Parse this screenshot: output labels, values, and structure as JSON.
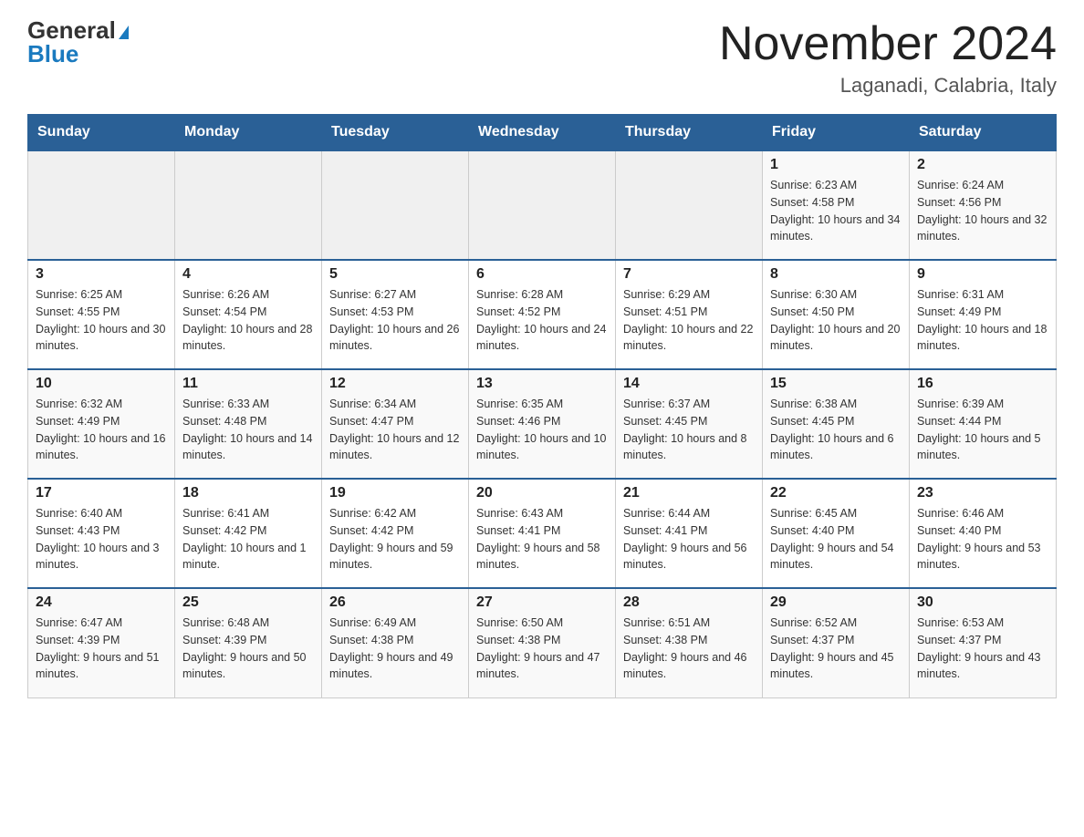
{
  "header": {
    "logo_general": "General",
    "logo_blue": "Blue",
    "title": "November 2024",
    "subtitle": "Laganadi, Calabria, Italy"
  },
  "days_of_week": [
    "Sunday",
    "Monday",
    "Tuesday",
    "Wednesday",
    "Thursday",
    "Friday",
    "Saturday"
  ],
  "weeks": [
    [
      {
        "day": "",
        "info": ""
      },
      {
        "day": "",
        "info": ""
      },
      {
        "day": "",
        "info": ""
      },
      {
        "day": "",
        "info": ""
      },
      {
        "day": "",
        "info": ""
      },
      {
        "day": "1",
        "info": "Sunrise: 6:23 AM\nSunset: 4:58 PM\nDaylight: 10 hours and 34 minutes."
      },
      {
        "day": "2",
        "info": "Sunrise: 6:24 AM\nSunset: 4:56 PM\nDaylight: 10 hours and 32 minutes."
      }
    ],
    [
      {
        "day": "3",
        "info": "Sunrise: 6:25 AM\nSunset: 4:55 PM\nDaylight: 10 hours and 30 minutes."
      },
      {
        "day": "4",
        "info": "Sunrise: 6:26 AM\nSunset: 4:54 PM\nDaylight: 10 hours and 28 minutes."
      },
      {
        "day": "5",
        "info": "Sunrise: 6:27 AM\nSunset: 4:53 PM\nDaylight: 10 hours and 26 minutes."
      },
      {
        "day": "6",
        "info": "Sunrise: 6:28 AM\nSunset: 4:52 PM\nDaylight: 10 hours and 24 minutes."
      },
      {
        "day": "7",
        "info": "Sunrise: 6:29 AM\nSunset: 4:51 PM\nDaylight: 10 hours and 22 minutes."
      },
      {
        "day": "8",
        "info": "Sunrise: 6:30 AM\nSunset: 4:50 PM\nDaylight: 10 hours and 20 minutes."
      },
      {
        "day": "9",
        "info": "Sunrise: 6:31 AM\nSunset: 4:49 PM\nDaylight: 10 hours and 18 minutes."
      }
    ],
    [
      {
        "day": "10",
        "info": "Sunrise: 6:32 AM\nSunset: 4:49 PM\nDaylight: 10 hours and 16 minutes."
      },
      {
        "day": "11",
        "info": "Sunrise: 6:33 AM\nSunset: 4:48 PM\nDaylight: 10 hours and 14 minutes."
      },
      {
        "day": "12",
        "info": "Sunrise: 6:34 AM\nSunset: 4:47 PM\nDaylight: 10 hours and 12 minutes."
      },
      {
        "day": "13",
        "info": "Sunrise: 6:35 AM\nSunset: 4:46 PM\nDaylight: 10 hours and 10 minutes."
      },
      {
        "day": "14",
        "info": "Sunrise: 6:37 AM\nSunset: 4:45 PM\nDaylight: 10 hours and 8 minutes."
      },
      {
        "day": "15",
        "info": "Sunrise: 6:38 AM\nSunset: 4:45 PM\nDaylight: 10 hours and 6 minutes."
      },
      {
        "day": "16",
        "info": "Sunrise: 6:39 AM\nSunset: 4:44 PM\nDaylight: 10 hours and 5 minutes."
      }
    ],
    [
      {
        "day": "17",
        "info": "Sunrise: 6:40 AM\nSunset: 4:43 PM\nDaylight: 10 hours and 3 minutes."
      },
      {
        "day": "18",
        "info": "Sunrise: 6:41 AM\nSunset: 4:42 PM\nDaylight: 10 hours and 1 minute."
      },
      {
        "day": "19",
        "info": "Sunrise: 6:42 AM\nSunset: 4:42 PM\nDaylight: 9 hours and 59 minutes."
      },
      {
        "day": "20",
        "info": "Sunrise: 6:43 AM\nSunset: 4:41 PM\nDaylight: 9 hours and 58 minutes."
      },
      {
        "day": "21",
        "info": "Sunrise: 6:44 AM\nSunset: 4:41 PM\nDaylight: 9 hours and 56 minutes."
      },
      {
        "day": "22",
        "info": "Sunrise: 6:45 AM\nSunset: 4:40 PM\nDaylight: 9 hours and 54 minutes."
      },
      {
        "day": "23",
        "info": "Sunrise: 6:46 AM\nSunset: 4:40 PM\nDaylight: 9 hours and 53 minutes."
      }
    ],
    [
      {
        "day": "24",
        "info": "Sunrise: 6:47 AM\nSunset: 4:39 PM\nDaylight: 9 hours and 51 minutes."
      },
      {
        "day": "25",
        "info": "Sunrise: 6:48 AM\nSunset: 4:39 PM\nDaylight: 9 hours and 50 minutes."
      },
      {
        "day": "26",
        "info": "Sunrise: 6:49 AM\nSunset: 4:38 PM\nDaylight: 9 hours and 49 minutes."
      },
      {
        "day": "27",
        "info": "Sunrise: 6:50 AM\nSunset: 4:38 PM\nDaylight: 9 hours and 47 minutes."
      },
      {
        "day": "28",
        "info": "Sunrise: 6:51 AM\nSunset: 4:38 PM\nDaylight: 9 hours and 46 minutes."
      },
      {
        "day": "29",
        "info": "Sunrise: 6:52 AM\nSunset: 4:37 PM\nDaylight: 9 hours and 45 minutes."
      },
      {
        "day": "30",
        "info": "Sunrise: 6:53 AM\nSunset: 4:37 PM\nDaylight: 9 hours and 43 minutes."
      }
    ]
  ]
}
